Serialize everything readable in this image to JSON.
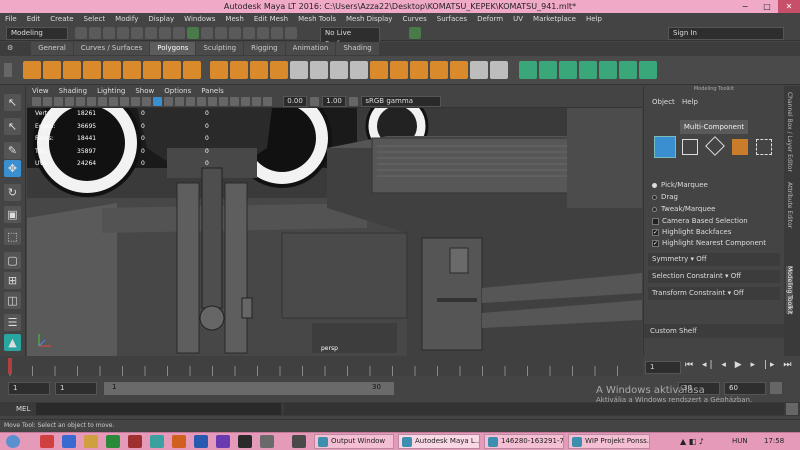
{
  "window": {
    "title": "Autodesk Maya LT 2016: C:\\Users\\Azza22\\Desktop\\KOMATSU_KEPEK\\KOMATSU_941.mlt*",
    "min": "−",
    "max": "□",
    "close": "✕"
  },
  "menu": [
    "File",
    "Edit",
    "Create",
    "Select",
    "Modify",
    "Display",
    "Windows",
    "Mesh",
    "Edit Mesh",
    "Mesh Tools",
    "Mesh Display",
    "Curves",
    "Surfaces",
    "Deform",
    "UV",
    "Marketplace",
    "Help"
  ],
  "statusline": {
    "mode": "Modeling",
    "live_surface": "No Live Surface",
    "signin": "Sign In"
  },
  "shelf_tabs": [
    "General",
    "Curves / Surfaces",
    "Polygons",
    "Sculpting",
    "Rigging",
    "Animation",
    "Shading"
  ],
  "shelf_active": "Polygons",
  "viewport": {
    "menu": [
      "View",
      "Shading",
      "Lighting",
      "Show",
      "Options",
      "Panels"
    ],
    "exposure": "0.00",
    "gamma": "1.00",
    "colorspace": "sRGB gamma",
    "hud": [
      {
        "label": "Verts:",
        "a": "18261",
        "b": "0",
        "c": "0"
      },
      {
        "label": "Edges:",
        "a": "36695",
        "b": "0",
        "c": "0"
      },
      {
        "label": "Faces:",
        "a": "18441",
        "b": "0",
        "c": "0"
      },
      {
        "label": "Tris:",
        "a": "35897",
        "b": "0",
        "c": "0"
      },
      {
        "label": "UVs:",
        "a": "24264",
        "b": "0",
        "c": "0"
      }
    ],
    "camera": "persp"
  },
  "toolkit": {
    "title": "Modeling Toolkit",
    "menu": [
      "Object",
      "Help"
    ],
    "component_button": "Multi-Component",
    "modes": [
      "Pick/Marquee",
      "Drag",
      "Tweak/Marquee"
    ],
    "checks": [
      {
        "label": "Camera Based Selection",
        "checked": false
      },
      {
        "label": "Highlight Backfaces",
        "checked": true
      },
      {
        "label": "Highlight Nearest Component",
        "checked": true
      }
    ],
    "symmetry": {
      "label": "Symmetry",
      "value": "Off"
    },
    "selection_constraint": {
      "label": "Selection Constraint",
      "value": "Off"
    },
    "transform_constraint": {
      "label": "Transform Constraint",
      "value": "Off"
    },
    "custom_shelf": "Custom Shelf"
  },
  "side_tabs": [
    "Channel Box / Layer Editor",
    "Attribute Editor",
    "Modeling Toolkit"
  ],
  "timeline": {
    "ticks": [
      "1",
      "2",
      "3",
      "4",
      "5",
      "6",
      "7",
      "8",
      "9",
      "10",
      "11",
      "12",
      "13",
      "14",
      "15",
      "16",
      "17",
      "18",
      "19",
      "20",
      "21",
      "22",
      "23",
      "24",
      "25",
      "26",
      "27",
      "28"
    ],
    "current": "1"
  },
  "range": {
    "start": "1",
    "anim_start": "1",
    "slider_start": "1",
    "slider_end": "30",
    "end": "30",
    "anim_end": "60"
  },
  "mel": {
    "label": "MEL"
  },
  "help_line": "Move Tool: Select an object to move.",
  "watermark": {
    "line1": "A Windows aktiválása",
    "line2": "Aktiválja a Windows rendszert a Gépházban."
  },
  "taskbar": {
    "tasks": [
      "Output Window",
      "Autodesk Maya L...",
      "146280-163291-79...",
      "WIP Projekt Ponss..."
    ],
    "lang": "HUN",
    "time": "17:58"
  },
  "colors": {
    "title_bg": "#f0aac8",
    "taskbar_bg": "#e59ab9",
    "shelf_orange": "#d98a2b",
    "shelf_green": "#3aa77a",
    "selected_blue": "#3a8fd0"
  }
}
